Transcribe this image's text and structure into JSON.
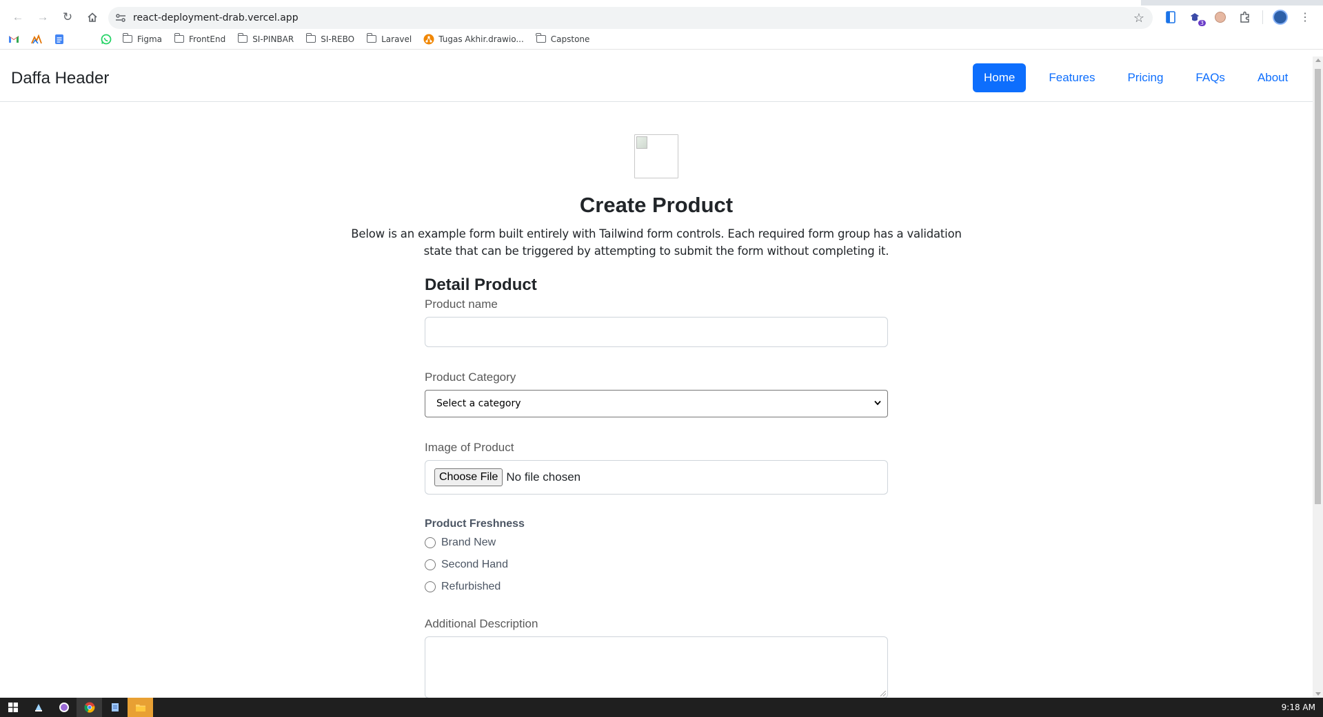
{
  "browser": {
    "url": "react-deployment-drab.vercel.app",
    "extensions_badge": "3",
    "bookmarks": [
      {
        "label": "",
        "icon": "gmail-icon"
      },
      {
        "label": "",
        "icon": "chart-icon"
      },
      {
        "label": "",
        "icon": "docs-icon"
      },
      {
        "label": "",
        "icon": "whatsapp-icon"
      },
      {
        "label": "Figma",
        "icon": "folder-icon"
      },
      {
        "label": "FrontEnd",
        "icon": "folder-icon"
      },
      {
        "label": "SI-PINBAR",
        "icon": "folder-icon"
      },
      {
        "label": "SI-REBO",
        "icon": "folder-icon"
      },
      {
        "label": "Laravel",
        "icon": "folder-icon"
      },
      {
        "label": "Tugas Akhir.drawio...",
        "icon": "drawio-icon"
      },
      {
        "label": "Capstone",
        "icon": "folder-icon"
      }
    ]
  },
  "header": {
    "brand": "Daffa Header",
    "nav": [
      "Home",
      "Features",
      "Pricing",
      "FAQs",
      "About"
    ],
    "active_nav": "Home",
    "accent": "#0d6efd"
  },
  "page": {
    "title": "Create Product",
    "lead": "Below is an example form built entirely with Tailwind form controls. Each required form group has a validation state that can be triggered by attempting to submit the form without completing it."
  },
  "form": {
    "section_title": "Detail Product",
    "product_name_label": "Product name",
    "product_name_value": "",
    "category_label": "Product Category",
    "category_selected": "Select a category",
    "image_label": "Image of Product",
    "file_button": "Choose File",
    "file_status": "No file chosen",
    "freshness_label": "Product Freshness",
    "freshness_options": [
      "Brand New",
      "Second Hand",
      "Refurbished"
    ],
    "description_label": "Additional Description",
    "description_value": ""
  },
  "taskbar": {
    "time": "9:18 AM"
  }
}
